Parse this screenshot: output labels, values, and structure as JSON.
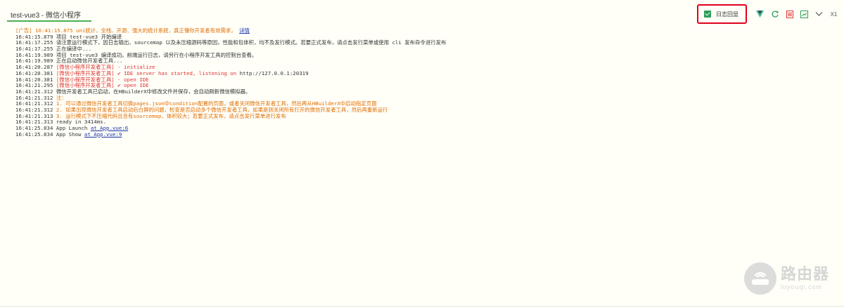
{
  "tab": {
    "title": "test-vue3 - 微信小程序"
  },
  "toolbar": {
    "autoscroll_label": "日志回显",
    "collapse_label": "X1",
    "icons": [
      "vue-icon",
      "refresh-icon",
      "clear-icon",
      "export-icon",
      "chevron-down-icon"
    ]
  },
  "console": {
    "lines": [
      [
        {
          "t": "[广告] 16:41:15.875 uni统计，全栈、开源、强大的统计系统，真正懂你开发者有效需求， ",
          "c": "warn"
        },
        {
          "t": "详情",
          "c": "link"
        }
      ],
      [
        {
          "t": "16:41:15.879 ",
          "c": "ts"
        },
        {
          "t": "项目 test-vue3 开始编译",
          "c": ""
        }
      ],
      [
        {
          "t": "16:41:17.255 ",
          "c": "ts"
        },
        {
          "t": "请注意运行模式下，因日志输出、sourcemap 以及未压缩源码等原因，性能和包体积，均不及发行模式。若要正式发布，请点击发行菜单或使用 cli 发布命令进行发布",
          "c": ""
        }
      ],
      [
        {
          "t": "16:41:17.255 ",
          "c": "ts"
        },
        {
          "t": "正在编译中...",
          "c": ""
        }
      ],
      [
        {
          "t": "16:41:19.989 ",
          "c": "ts"
        },
        {
          "t": "项目 test-vue3 编译成功。前端运行日志，请另行在小程序开发工具的控制台查看。",
          "c": ""
        }
      ],
      [
        {
          "t": "16:41:19.989 ",
          "c": "ts"
        },
        {
          "t": "正在启动微信开发者工具...",
          "c": ""
        }
      ],
      [
        {
          "t": "16:41:20.287 ",
          "c": "ts"
        },
        {
          "t": "[微信小程序开发者工具] - initialize",
          "c": "err"
        }
      ],
      [
        {
          "t": "16:41:20.381 ",
          "c": "ts"
        },
        {
          "t": "[微信小程序开发者工具] ✔ IDE server has started, listening on ",
          "c": "err"
        },
        {
          "t": "http://127.0.0.1:20319",
          "c": ""
        }
      ],
      [
        {
          "t": "16:41:20.381 ",
          "c": "ts"
        },
        {
          "t": "[微信小程序开发者工具] - open IDE",
          "c": "err"
        }
      ],
      [
        {
          "t": "16:41:21.295 ",
          "c": "ts"
        },
        {
          "t": "[微信小程序开发者工具] ✔ open IDE",
          "c": "err"
        }
      ],
      [
        {
          "t": "16:41:21.312 ",
          "c": "ts"
        },
        {
          "t": "微信开发者工具已启动，在HBuilderX中修改文件并保存，会自动刷新微信模拟器。",
          "c": ""
        }
      ],
      [
        {
          "t": "16:41:21.312 ",
          "c": "ts"
        },
        {
          "t": "注：",
          "c": "warn"
        }
      ],
      [
        {
          "t": "16:41:21.312 ",
          "c": "ts"
        },
        {
          "t": "1. 可以通过微信开发者工具切换pages.json中condition配置的页面，或者关闭微信开发者工具，然后再从HBuilderX中启动指定页面",
          "c": "warn"
        }
      ],
      [
        {
          "t": "16:41:21.312 ",
          "c": "ts"
        },
        {
          "t": "2. 如果出现微信开发者工具启动后白屏的问题，检查是否启动多个微信开发者工具，如果是则关闭所有打开的微信开发者工具，然后再重新运行",
          "c": "warn"
        }
      ],
      [
        {
          "t": "16:41:21.313 ",
          "c": "ts"
        },
        {
          "t": "3. 运行模式下不压缩代码且含有sourcemap，体积较大；若要正式发布，请点击发行菜单进行发布",
          "c": "warn"
        }
      ],
      [
        {
          "t": "16:41:21.313 ",
          "c": "ts"
        },
        {
          "t": "ready in 3414ms.",
          "c": ""
        }
      ],
      [
        {
          "t": "16:41:25.834 ",
          "c": "ts"
        },
        {
          "t": "App Launch ",
          "c": ""
        },
        {
          "t": "at App.vue:6",
          "c": "link"
        }
      ],
      [
        {
          "t": "16:41:25.834 ",
          "c": "ts"
        },
        {
          "t": "App Show ",
          "c": ""
        },
        {
          "t": "at App.vue:9",
          "c": "link"
        }
      ]
    ]
  },
  "watermark": {
    "cn": "路由器",
    "en": "luyouqi.com"
  },
  "colors": {
    "accent": "#4caf50",
    "warn": "#e06c00",
    "error": "#dd3333",
    "link": "#1a33a8",
    "highlight": "#e0001b"
  }
}
